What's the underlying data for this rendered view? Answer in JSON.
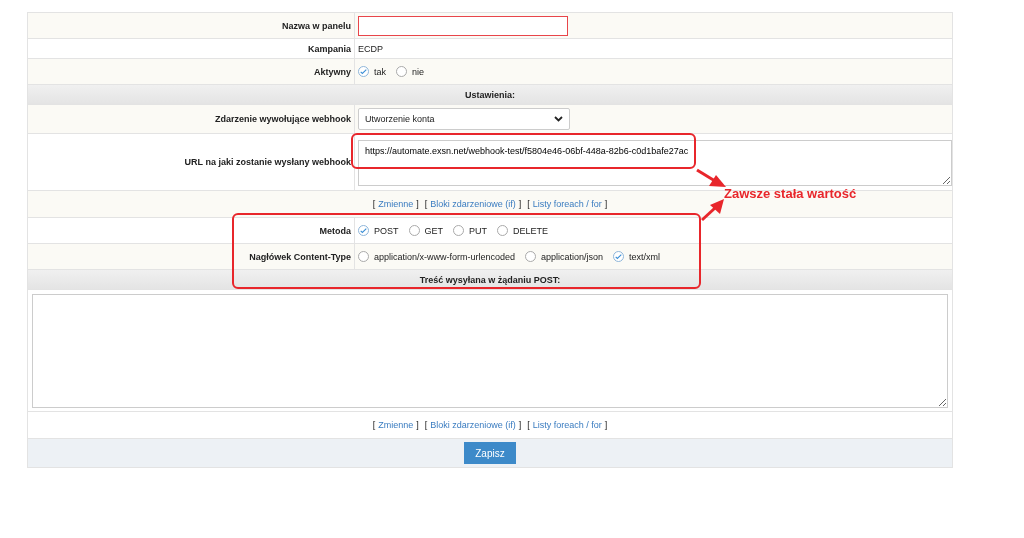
{
  "form": {
    "rows": [
      {
        "kind": "text",
        "label": "Nazwa w panelu",
        "value": "",
        "invalid": true
      },
      {
        "kind": "static",
        "label": "Kampania",
        "value": "ECDP"
      },
      {
        "kind": "radio",
        "label": "Aktywny",
        "options": [
          {
            "label": "tak",
            "selected": true
          },
          {
            "label": "nie",
            "selected": false
          }
        ]
      },
      {
        "kind": "header",
        "label": "Ustawienia:"
      },
      {
        "kind": "select",
        "label": "Zdarzenie wywołujące webhook",
        "value": "Utworzenie konta"
      },
      {
        "kind": "textarea",
        "label": "URL na jaki zostanie wysłany webhook",
        "value": "https://automate.exsn.net/webhook-test/f5804e46-06bf-448a-82b6-c0d1bafe27ac"
      },
      {
        "kind": "links",
        "brackets": [
          "[",
          "]"
        ],
        "links": [
          {
            "label": "Zmienne"
          },
          {
            "label": "Bloki zdarzeniowe (if)"
          },
          {
            "label": "Listy foreach / for"
          }
        ]
      },
      {
        "kind": "radio",
        "label": "Metoda",
        "options": [
          {
            "label": "POST",
            "selected": true
          },
          {
            "label": "GET",
            "selected": false
          },
          {
            "label": "PUT",
            "selected": false
          },
          {
            "label": "DELETE",
            "selected": false
          }
        ]
      },
      {
        "kind": "radio",
        "label": "Nagłówek Content-Type",
        "options": [
          {
            "label": "application/x-www-form-urlencoded",
            "selected": false
          },
          {
            "label": "application/json",
            "selected": false
          },
          {
            "label": "text/xml",
            "selected": true
          }
        ]
      },
      {
        "kind": "header",
        "label": "Treść wysyłana w żądaniu POST:"
      },
      {
        "kind": "body",
        "value": ""
      },
      {
        "kind": "links",
        "brackets": [
          "[",
          "]"
        ],
        "links": [
          {
            "label": "Zmienne"
          },
          {
            "label": "Bloki zdarzeniowe (if)"
          },
          {
            "label": "Listy foreach / for"
          }
        ]
      },
      {
        "kind": "submit",
        "label": "Zapisz"
      }
    ]
  },
  "annotation": {
    "text": "Zawsze stała wartość"
  }
}
